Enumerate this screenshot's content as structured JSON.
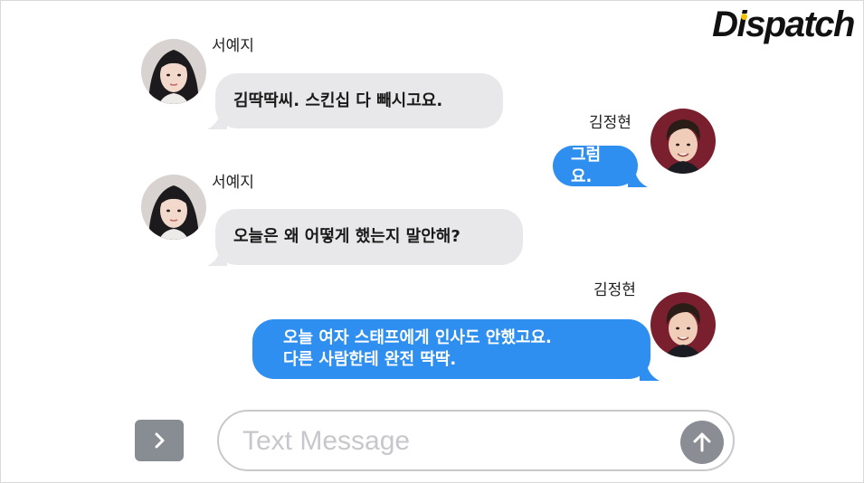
{
  "brand": {
    "logo_text": "Dispatch",
    "accent": "#f2c200"
  },
  "messages": [
    {
      "sender": "서예지",
      "direction": "incoming",
      "lines": [
        "김딱딱씨. 스킨십 다 빼시고요."
      ]
    },
    {
      "sender": "김정현",
      "direction": "outgoing",
      "lines": [
        "그럼요."
      ]
    },
    {
      "sender": "서예지",
      "direction": "incoming",
      "lines": [
        "오늘은 왜 어떻게 했는지 말안해?"
      ]
    },
    {
      "sender": "김정현",
      "direction": "outgoing",
      "lines": [
        "오늘 여자 스태프에게 인사도 안했고요.",
        "다른 사람한테 완전 딱딱."
      ]
    }
  ],
  "composer": {
    "placeholder": "Text Message",
    "expand_icon": "chevron-right-icon",
    "send_icon": "arrow-up-icon"
  },
  "colors": {
    "incoming_bubble": "#e8e8ea",
    "outgoing_bubble": "#2f8ff0",
    "button_gray": "#888d93"
  }
}
